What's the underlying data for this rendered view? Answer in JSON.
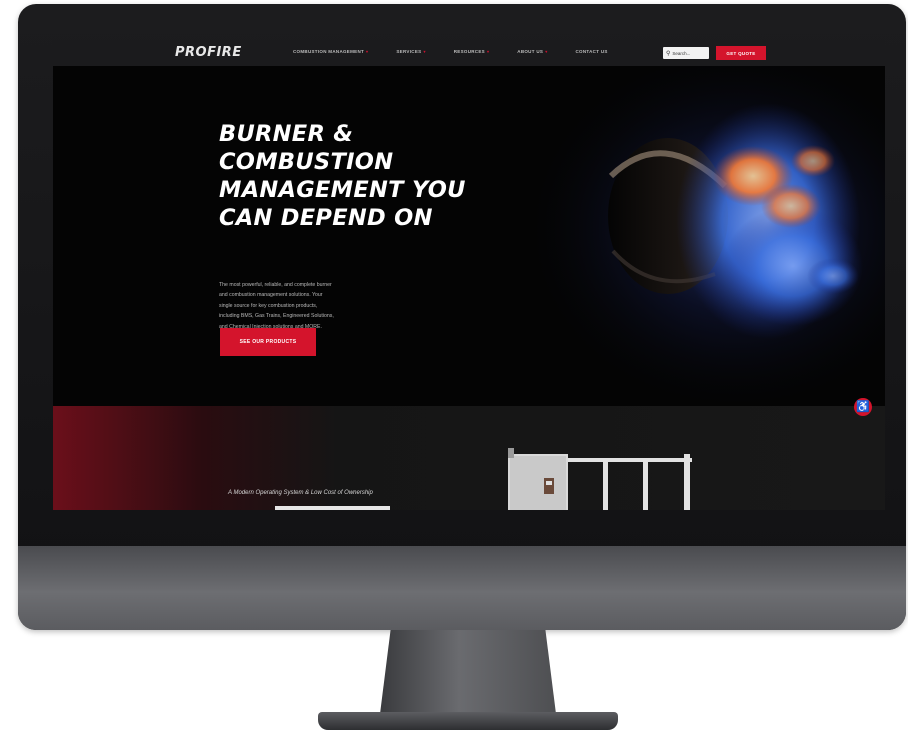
{
  "site": {
    "logo": "PROFIRE"
  },
  "nav": {
    "items": [
      {
        "label": "COMBUSTION MANAGEMENT",
        "has_chevron": true
      },
      {
        "label": "SERVICES",
        "has_chevron": true
      },
      {
        "label": "RESOURCES",
        "has_chevron": true
      },
      {
        "label": "ABOUT US",
        "has_chevron": true
      },
      {
        "label": "CONTACT US",
        "has_chevron": false
      }
    ],
    "search_placeholder": "Search...",
    "search_icon": "search-icon",
    "cta_label": "GET QUOTE"
  },
  "hero": {
    "title_lines": [
      "BURNER &",
      "COMBUSTION",
      "MANAGEMENT YOU",
      "CAN DEPEND ON"
    ],
    "body_lines": [
      "The most powerful, reliable, and complete burner",
      "and combustion management solutions. Your",
      "single source for key combustion products,",
      "including BMS, Gas Trains, Engineered Solutions,",
      "and Chemical Injection solutions and MORE."
    ],
    "button_label": "SEE OUR PRODUCTS"
  },
  "lower": {
    "tagline": "A Modern Operating System & Low Cost of Ownership"
  },
  "accessibility": {
    "icon": "accessibility-icon",
    "glyph": "♿"
  },
  "colors": {
    "brand_red": "#d4142c",
    "nav_bg": "#1b1b1d",
    "hero_bg": "#040404",
    "flame_blue": "#3a6fe0",
    "flame_orange": "#ff7a2a"
  }
}
